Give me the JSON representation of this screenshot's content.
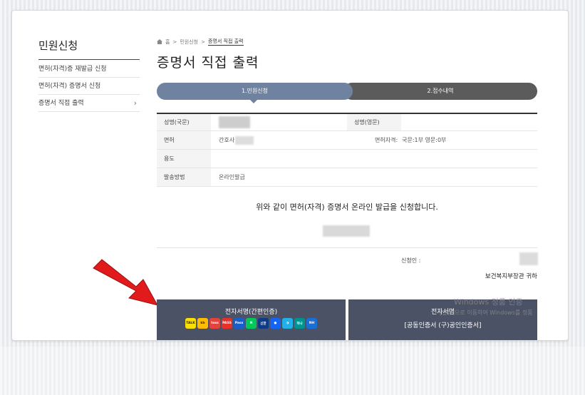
{
  "sidebar": {
    "title": "민원신청",
    "items": [
      {
        "label": "면허(자격)증 재발급 신청"
      },
      {
        "label": "면허(자격) 증명서 신청"
      },
      {
        "label": "증명서 직접 출력",
        "chevron": "›"
      }
    ]
  },
  "breadcrumb": {
    "home": "홈",
    "sep": ">",
    "level1": "민원신청",
    "current": "증명서 직접 출력"
  },
  "page": {
    "title": "증명서 직접 출력"
  },
  "steps": [
    {
      "label": "1.민원신청",
      "active": true
    },
    {
      "label": "2.접수내역",
      "active": false
    }
  ],
  "info": {
    "name_kr_label": "성명(국문)",
    "name_en_label": "성명(영문)",
    "license_label": "면허",
    "license_value": "간호사",
    "qual_label": "면허자격:",
    "qual_value": "국문:1부 영문:0부",
    "purpose_label": "용도",
    "delivery_label": "발송방법",
    "delivery_value": "온라인발급"
  },
  "statement": "위와 같이 면허(자격) 증명서 온라인 발급을 신청합니다.",
  "applicant_label": "신청인 :",
  "addressee": "보건복지부장관 귀하",
  "sign_simple": {
    "label": "전자서명(간편인증)",
    "providers": [
      {
        "name": "TALK",
        "color": "#f9e000",
        "text_color": "#3a1d1d"
      },
      {
        "name": "kb",
        "color": "#ffbc00",
        "text_color": "#3a2a00"
      },
      {
        "name": "toss",
        "color": "#e2433c",
        "text_color": "#ffffff"
      },
      {
        "name": "PASS",
        "color": "#e7302a",
        "text_color": "#ffffff"
      },
      {
        "name": "Pass",
        "color": "#1a5ec9",
        "text_color": "#ffffff"
      },
      {
        "name": "N",
        "color": "#03c75a",
        "text_color": "#ffffff"
      },
      {
        "name": "신한",
        "color": "#0d3b86",
        "text_color": "#ffffff"
      },
      {
        "name": "●",
        "color": "#1464f6",
        "text_color": "#ffffff"
      },
      {
        "name": "◑",
        "color": "#23b0e8",
        "text_color": "#ffffff"
      },
      {
        "name": "하나",
        "color": "#009490",
        "text_color": "#ffffff"
      },
      {
        "name": "NH",
        "color": "#1a6ed8",
        "text_color": "#ffffff"
      }
    ]
  },
  "sign_cert": {
    "line1": "전자서명",
    "line2": "[공동인증서 (구)공인인증서]"
  },
  "watermark": {
    "line1": "Windows 정품 인증",
    "line2": "[설정]으로 이동하여 Windows를 정품"
  },
  "colors": {
    "step_active": "#6f83a1",
    "step_inactive": "#5b5b5b",
    "button": "#4b5266",
    "arrow": "#e11b1b"
  }
}
